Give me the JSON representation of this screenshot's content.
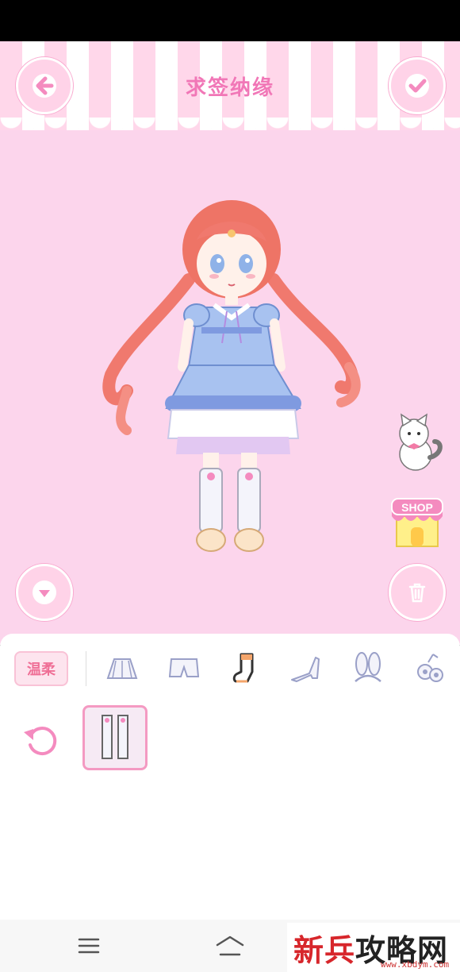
{
  "header": {
    "title": "求签纳缘",
    "back_icon": "arrow-left-icon",
    "confirm_icon": "checkmark-icon"
  },
  "stage": {
    "down_icon": "chevron-down-icon",
    "trash_icon": "trash-icon",
    "shop_label": "SHOP",
    "colors": {
      "background": "#fcd5ec",
      "accent": "#f177b7"
    }
  },
  "panel": {
    "style_tag": "温柔",
    "categories": [
      {
        "icon": "skirt-icon",
        "selected": false
      },
      {
        "icon": "shorts-icon",
        "selected": false
      },
      {
        "icon": "sock-icon",
        "selected": true
      },
      {
        "icon": "high-heel-icon",
        "selected": false
      },
      {
        "icon": "bunny-ears-icon",
        "selected": false
      },
      {
        "icon": "flower-accessory-icon",
        "selected": false
      }
    ],
    "reset_icon": "reset-icon",
    "items": [
      {
        "icon": "stockings-item-icon",
        "selected": true
      }
    ]
  },
  "navbar": {
    "icons": [
      "menu-icon",
      "home-icon"
    ]
  },
  "watermark": {
    "text_red": "新兵",
    "text_black": "攻略网",
    "url": "www.xbdym.com"
  }
}
